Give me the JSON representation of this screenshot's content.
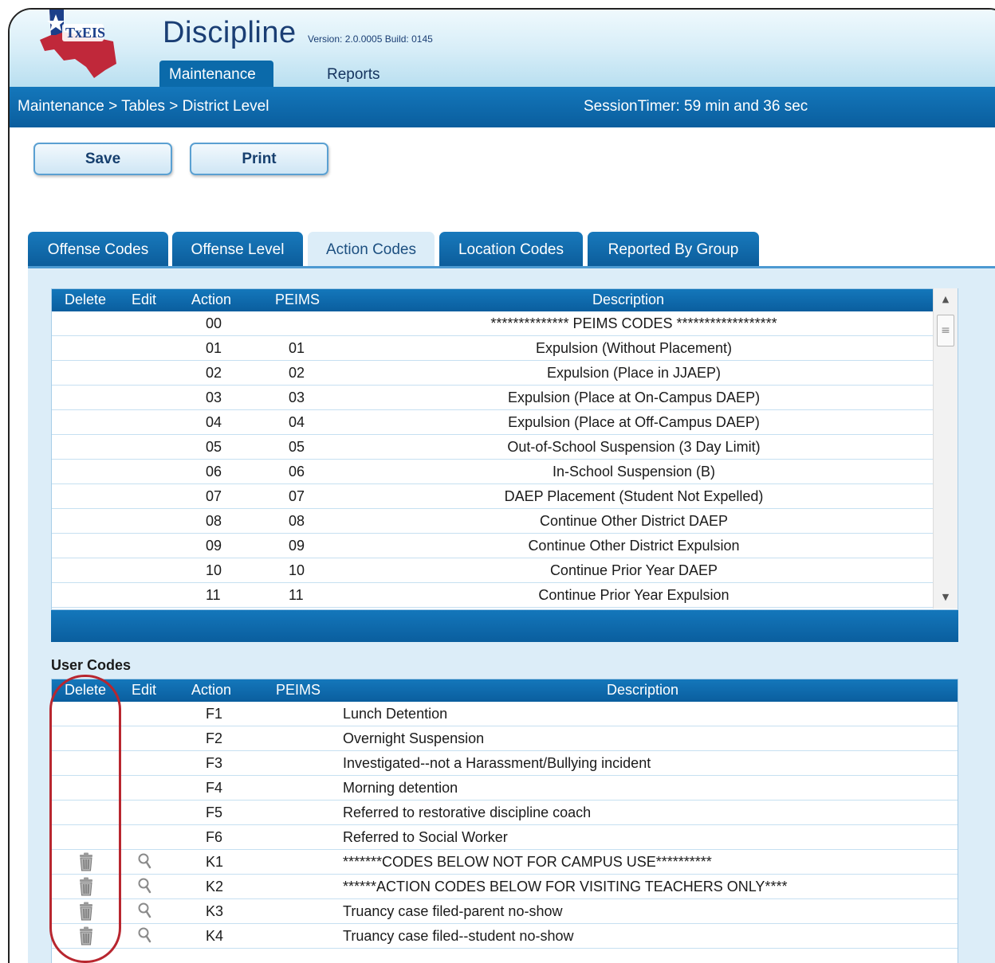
{
  "app": {
    "title": "Discipline",
    "version": "Version: 2.0.0005 Build: 0145",
    "logo_text": "TxEIS"
  },
  "nav": {
    "tabs": [
      {
        "label": "Maintenance",
        "active": true
      },
      {
        "label": "Reports",
        "active": false
      }
    ]
  },
  "breadcrumb": "Maintenance > Tables > District Level",
  "session_timer": "SessionTimer: 59 min and 36 sec",
  "toolbar": {
    "save_label": "Save",
    "print_label": "Print"
  },
  "tabs": [
    {
      "label": "Offense Codes",
      "active": false
    },
    {
      "label": "Offense Level",
      "active": false
    },
    {
      "label": "Action Codes",
      "active": true
    },
    {
      "label": "Location Codes",
      "active": false
    },
    {
      "label": "Reported By Group",
      "active": false
    }
  ],
  "peims_table": {
    "columns": [
      "Delete",
      "Edit",
      "Action",
      "PEIMS",
      "Description"
    ],
    "rows": [
      {
        "action": "00",
        "peims": "",
        "description": "************** PEIMS CODES ******************"
      },
      {
        "action": "01",
        "peims": "01",
        "description": "Expulsion (Without Placement)"
      },
      {
        "action": "02",
        "peims": "02",
        "description": "Expulsion (Place in JJAEP)"
      },
      {
        "action": "03",
        "peims": "03",
        "description": "Expulsion (Place at On-Campus DAEP)"
      },
      {
        "action": "04",
        "peims": "04",
        "description": "Expulsion (Place at Off-Campus DAEP)"
      },
      {
        "action": "05",
        "peims": "05",
        "description": "Out-of-School Suspension (3 Day Limit)"
      },
      {
        "action": "06",
        "peims": "06",
        "description": "In-School Suspension (B)"
      },
      {
        "action": "07",
        "peims": "07",
        "description": "DAEP Placement (Student Not Expelled)"
      },
      {
        "action": "08",
        "peims": "08",
        "description": "Continue Other District DAEP"
      },
      {
        "action": "09",
        "peims": "09",
        "description": "Continue Other District Expulsion"
      },
      {
        "action": "10",
        "peims": "10",
        "description": "Continue Prior Year DAEP"
      },
      {
        "action": "11",
        "peims": "11",
        "description": "Continue Prior Year Expulsion"
      }
    ]
  },
  "user_codes": {
    "title": "User Codes",
    "columns": [
      "Delete",
      "Edit",
      "Action",
      "PEIMS",
      "Description"
    ],
    "rows": [
      {
        "action": "F1",
        "peims": "",
        "description": "Lunch Detention",
        "editable": false
      },
      {
        "action": "F2",
        "peims": "",
        "description": "Overnight Suspension",
        "editable": false
      },
      {
        "action": "F3",
        "peims": "",
        "description": "Investigated--not a Harassment/Bullying incident",
        "editable": false
      },
      {
        "action": "F4",
        "peims": "",
        "description": "Morning detention",
        "editable": false
      },
      {
        "action": "F5",
        "peims": "",
        "description": "Referred to restorative discipline coach",
        "editable": false
      },
      {
        "action": "F6",
        "peims": "",
        "description": "Referred to Social Worker",
        "editable": false
      },
      {
        "action": "K1",
        "peims": "",
        "description": "*******CODES BELOW NOT FOR CAMPUS USE**********",
        "editable": true
      },
      {
        "action": "K2",
        "peims": "",
        "description": "******ACTION CODES BELOW FOR VISITING TEACHERS ONLY****",
        "editable": true
      },
      {
        "action": "K3",
        "peims": "",
        "description": "Truancy case filed-parent no-show",
        "editable": true
      },
      {
        "action": "K4",
        "peims": "",
        "description": "Truancy case filed--student no-show",
        "editable": true
      }
    ]
  },
  "icons": {
    "delete": "trash-icon",
    "edit": "magnifier-icon"
  },
  "colors": {
    "header_blue": "#0b6aaa",
    "panel_bg": "#dcedf8",
    "highlight_red": "#b8262f"
  }
}
